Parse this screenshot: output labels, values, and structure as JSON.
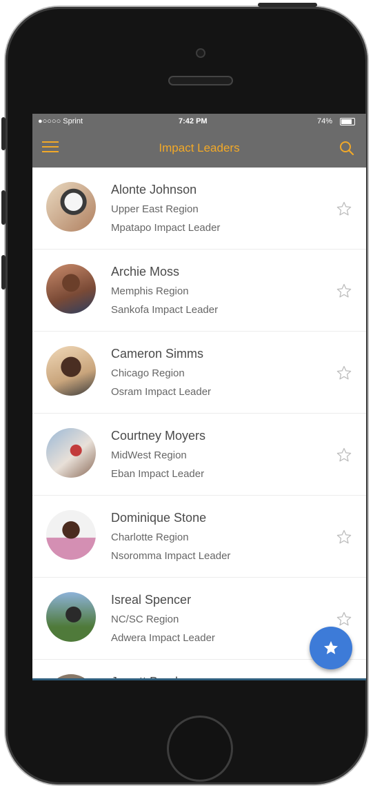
{
  "status_bar": {
    "carrier": "●○○○○ Sprint",
    "time": "7:42 PM",
    "battery": "74%",
    "battery_level": 0.74
  },
  "nav": {
    "title": "Impact Leaders",
    "menu_icon": "hamburger-menu-icon",
    "search_icon": "search-icon"
  },
  "leaders": [
    {
      "name": "Alonte  Johnson",
      "region": "Upper East Region",
      "role": "Mpatapo Impact Leader",
      "favorite": false
    },
    {
      "name": "Archie  Moss",
      "region": "Memphis Region",
      "role": "Sankofa Impact Leader",
      "favorite": false
    },
    {
      "name": "Cameron Simms",
      "region": "Chicago Region",
      "role": "Osram Impact Leader",
      "favorite": false
    },
    {
      "name": "Courtney Moyers",
      "region": "MidWest Region",
      "role": "Eban Impact Leader",
      "favorite": false
    },
    {
      "name": "Dominique  Stone",
      "region": "Charlotte Region",
      "role": "Nsoromma Impact Leader",
      "favorite": false
    },
    {
      "name": "Isreal Spencer",
      "region": "NC/SC Region",
      "role": "Adwera Impact Leader",
      "favorite": false
    },
    {
      "name": "Jarrett Brock",
      "region": "",
      "role": "",
      "favorite": false
    }
  ],
  "fab": {
    "icon": "star-icon"
  },
  "colors": {
    "nav_bg": "#6b6b6b",
    "accent": "#f2a928",
    "fab": "#3d7bd8"
  }
}
